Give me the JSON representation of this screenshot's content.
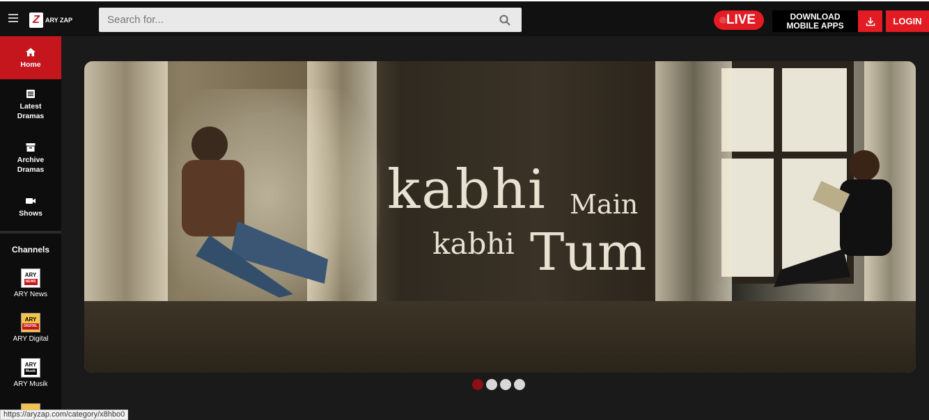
{
  "header": {
    "logo_text": "ARY ZAP",
    "search_placeholder": "Search for...",
    "live_label": "LIVE",
    "download_line1": "DOWNLOAD",
    "download_line2": "MOBILE APPS",
    "login_label": "LOGIN"
  },
  "sidebar": {
    "items": [
      {
        "label": "Home",
        "icon": "home-icon",
        "active": true
      },
      {
        "label_line1": "Latest",
        "label_line2": "Dramas",
        "icon": "list-icon"
      },
      {
        "label_line1": "Archive",
        "label_line2": "Dramas",
        "icon": "archive-icon"
      },
      {
        "label": "Shows",
        "icon": "video-camera-icon"
      }
    ],
    "channels_title": "Channels",
    "channels": [
      {
        "name": "ARY News",
        "logo_top": "ARY",
        "logo_sub": "NEWS"
      },
      {
        "name": "ARY Digital",
        "logo_top": "ARY",
        "logo_sub": "DIGITAL"
      },
      {
        "name": "ARY Musik",
        "logo_top": "ARY",
        "logo_sub": "Musik"
      }
    ]
  },
  "banner": {
    "title_word1": "kabhi",
    "title_word2": "Main",
    "title_word3": "kabhi",
    "title_word4": "Tum",
    "slides": 4,
    "active_slide": 1
  },
  "status_url": "https://aryzap.com/category/x8hbo0",
  "colors": {
    "accent": "#e31b23",
    "sidebar_active": "#c4161c",
    "background": "#1a1a1a"
  }
}
